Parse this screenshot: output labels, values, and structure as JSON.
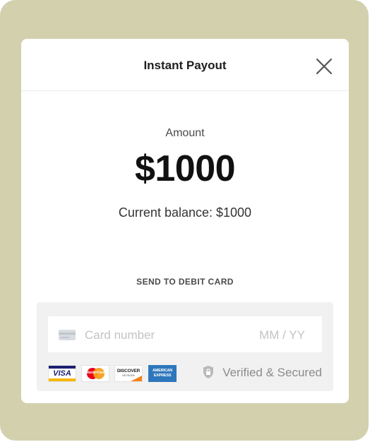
{
  "modal": {
    "title": "Instant Payout",
    "close_icon": "close-icon"
  },
  "amount": {
    "label": "Amount",
    "value": "$1000"
  },
  "balance": {
    "text": "Current balance: $1000"
  },
  "payout_method": {
    "label": "SEND TO DEBIT CARD",
    "card_number_placeholder": "Card number",
    "expiry_placeholder": "MM / YY",
    "card_icon": "credit-card-icon",
    "brands": [
      "VISA",
      "MasterCard",
      "DISCOVER",
      "AMERICAN EXPRESS"
    ],
    "discover_sub": "NETWORK",
    "secured_icon": "shield-lock-icon",
    "secured_text": "Verified & Secured"
  },
  "colors": {
    "backdrop": "#d3d0ae",
    "modal_bg": "#ffffff",
    "card_box_bg": "#f1f1f1",
    "amex_blue": "#2e77bc",
    "visa_blue": "#1a1f71"
  }
}
